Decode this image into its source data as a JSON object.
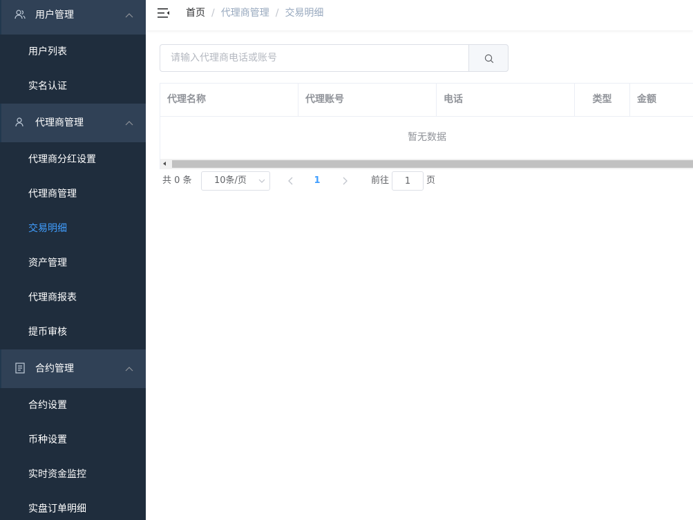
{
  "sidebar": {
    "groups": [
      {
        "label": "用户管理",
        "icon": "users-icon",
        "items": [
          {
            "label": "用户列表"
          },
          {
            "label": "实名认证"
          }
        ]
      },
      {
        "label": "代理商管理",
        "icon": "user-icon",
        "items": [
          {
            "label": "代理商分红设置"
          },
          {
            "label": "代理商管理"
          },
          {
            "label": "交易明细",
            "active": true
          },
          {
            "label": "资产管理"
          },
          {
            "label": "代理商报表"
          },
          {
            "label": "提币审核"
          }
        ]
      },
      {
        "label": "合约管理",
        "icon": "document-icon",
        "items": [
          {
            "label": "合约设置"
          },
          {
            "label": "币种设置"
          },
          {
            "label": "实时资金监控"
          },
          {
            "label": "实盘订单明细"
          }
        ]
      }
    ]
  },
  "header": {
    "breadcrumb": {
      "home": "首页",
      "separator": "/",
      "level1": "代理商管理",
      "level2": "交易明细"
    }
  },
  "search": {
    "placeholder": "请输入代理商电话或账号",
    "value": ""
  },
  "table": {
    "columns": [
      "代理名称",
      "代理账号",
      "电话",
      "类型",
      "金额"
    ],
    "rows": [],
    "empty_text": "暂无数据"
  },
  "pagination": {
    "total_text": "共 0 条",
    "page_size": "10条/页",
    "current_page": "1",
    "goto_label": "前往",
    "goto_value": "1",
    "goto_suffix": "页"
  },
  "colors": {
    "sidebar_bg": "#1f2d3d",
    "group_bg": "#304156",
    "accent": "#409eff",
    "header_text": "#909399"
  }
}
